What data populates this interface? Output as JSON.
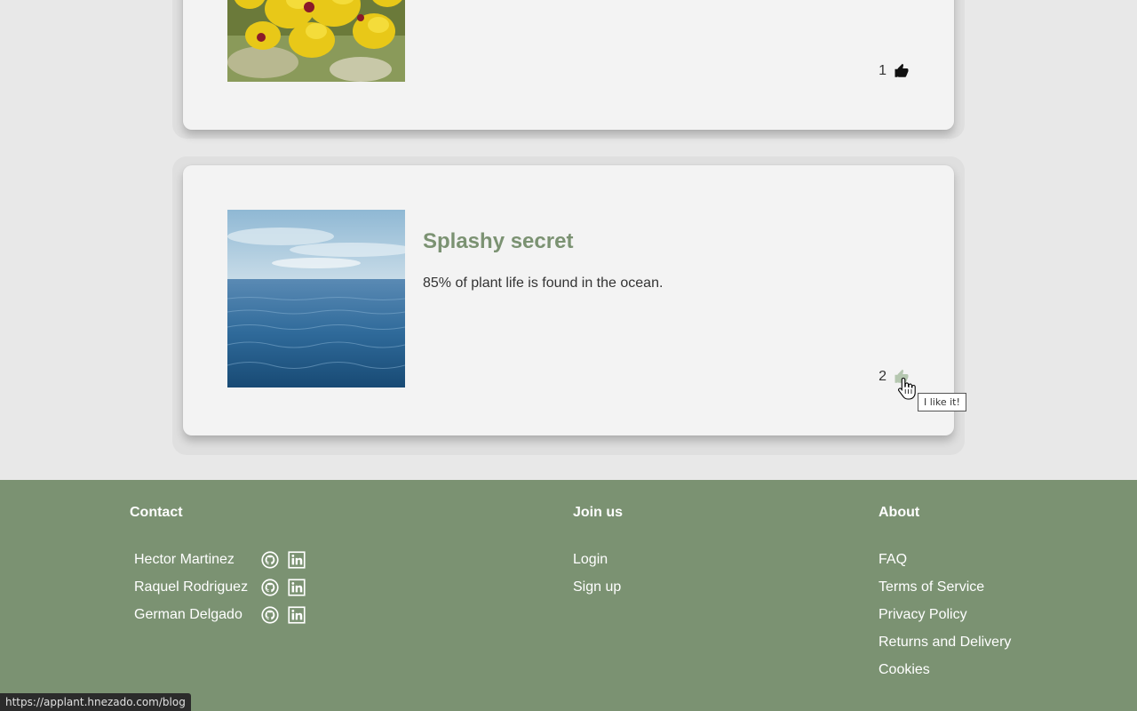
{
  "posts": [
    {
      "title": "",
      "text": "",
      "likes": "1",
      "like_icon": "thumbs-up-icon"
    },
    {
      "title": "Splashy secret",
      "text": "85% of plant life is found in the ocean.",
      "likes": "2",
      "like_icon": "thumbs-up-icon",
      "tooltip": "I like it!"
    }
  ],
  "footer": {
    "contact": {
      "heading": "Contact",
      "people": [
        {
          "name": "Hector Martinez",
          "icons": [
            "github-icon",
            "linkedin-icon"
          ]
        },
        {
          "name": "Raquel Rodriguez",
          "icons": [
            "github-icon",
            "linkedin-icon"
          ]
        },
        {
          "name": "German Delgado",
          "icons": [
            "github-icon",
            "linkedin-icon"
          ]
        }
      ]
    },
    "join": {
      "heading": "Join us",
      "links": [
        "Login",
        "Sign up"
      ]
    },
    "about": {
      "heading": "About",
      "links": [
        "FAQ",
        "Terms of Service",
        "Privacy Policy",
        "Returns and Delivery",
        "Cookies"
      ]
    }
  },
  "status_bar": {
    "url": "https://applant.hnezado.com/blog"
  },
  "colors": {
    "accent": "#7b9272",
    "background": "#e8e8e8",
    "card": "#f3f3f3"
  }
}
